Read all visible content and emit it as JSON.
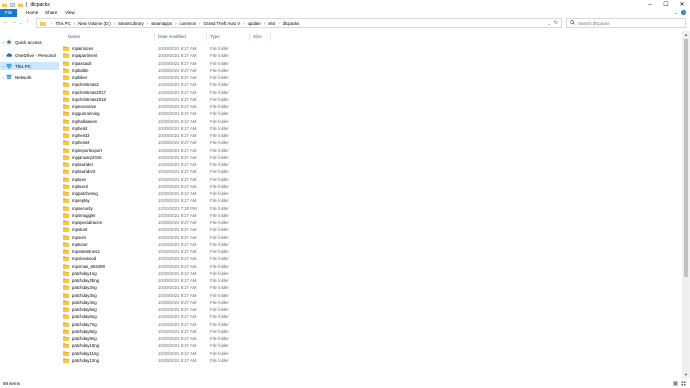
{
  "window": {
    "title": "dlcpacks",
    "qat_separator": "|",
    "controls": {
      "minimize": "–",
      "maximize": "☐",
      "close": "✕"
    }
  },
  "ribbon": {
    "tabs": [
      "File",
      "Home",
      "Share",
      "View"
    ],
    "help": "?"
  },
  "address_bar": {
    "crumbs": [
      "This PC",
      "New Volume (D:)",
      "SteamLibrary",
      "steamapps",
      "common",
      "Grand Theft Auto V",
      "update",
      "x64",
      "dlcpacks"
    ],
    "separator": "›"
  },
  "search": {
    "placeholder": "Search dlcpacks"
  },
  "nav": {
    "items": [
      {
        "label": "Quick access",
        "icon": "star-icon"
      },
      {
        "label": "OneDrive - Personal",
        "icon": "cloud-icon"
      },
      {
        "label": "This PC",
        "icon": "computer-icon"
      },
      {
        "label": "Network",
        "icon": "network-icon"
      }
    ]
  },
  "columns": {
    "name": "Name",
    "date": "Date modified",
    "type": "Type",
    "size": "Size"
  },
  "files": [
    {
      "name": "mpairraces",
      "date": "10/29/2021 9:27 AM",
      "type": "File folder"
    },
    {
      "name": "mpapartment",
      "date": "10/29/2021 9:27 AM",
      "type": "File folder"
    },
    {
      "name": "mpassault",
      "date": "10/29/2021 9:27 AM",
      "type": "File folder"
    },
    {
      "name": "mpbattle",
      "date": "10/29/2021 9:27 AM",
      "type": "File folder"
    },
    {
      "name": "mpbiker",
      "date": "10/29/2021 9:27 AM",
      "type": "File folder"
    },
    {
      "name": "mpchristmas2",
      "date": "10/29/2021 9:27 AM",
      "type": "File folder"
    },
    {
      "name": "mpchristmas2017",
      "date": "10/29/2021 9:27 AM",
      "type": "File folder"
    },
    {
      "name": "mpchristmas2018",
      "date": "10/29/2021 9:27 AM",
      "type": "File folder"
    },
    {
      "name": "mpexecutive",
      "date": "10/29/2021 9:27 AM",
      "type": "File folder"
    },
    {
      "name": "mpgunrunning",
      "date": "10/29/2021 9:27 AM",
      "type": "File folder"
    },
    {
      "name": "mphalloween",
      "date": "10/29/2021 9:27 AM",
      "type": "File folder"
    },
    {
      "name": "mpheist",
      "date": "10/29/2021 9:27 AM",
      "type": "File folder"
    },
    {
      "name": "mpheist3",
      "date": "10/29/2021 9:27 AM",
      "type": "File folder"
    },
    {
      "name": "mpheist4",
      "date": "10/29/2021 9:27 AM",
      "type": "File folder"
    },
    {
      "name": "mpimportexport",
      "date": "10/29/2021 9:27 AM",
      "type": "File folder"
    },
    {
      "name": "mpjanuary2016",
      "date": "10/29/2021 9:27 AM",
      "type": "File folder"
    },
    {
      "name": "mplowrider",
      "date": "10/29/2021 9:27 AM",
      "type": "File folder"
    },
    {
      "name": "mplowrider2",
      "date": "10/29/2021 9:27 AM",
      "type": "File folder"
    },
    {
      "name": "mpluxe",
      "date": "10/29/2021 9:27 AM",
      "type": "File folder"
    },
    {
      "name": "mpluxe2",
      "date": "10/29/2021 9:27 AM",
      "type": "File folder"
    },
    {
      "name": "mppatchesng",
      "date": "10/29/2021 9:27 AM",
      "type": "File folder"
    },
    {
      "name": "mpreplay",
      "date": "10/29/2021 9:27 AM",
      "type": "File folder"
    },
    {
      "name": "mpsecurity",
      "date": "12/24/2021 7:30 PM",
      "type": "File folder"
    },
    {
      "name": "mpsmuggler",
      "date": "10/29/2021 9:27 AM",
      "type": "File folder"
    },
    {
      "name": "mpspecialraces",
      "date": "10/29/2021 9:27 AM",
      "type": "File folder"
    },
    {
      "name": "mpstunt",
      "date": "10/29/2021 9:27 AM",
      "type": "File folder"
    },
    {
      "name": "mpsum",
      "date": "10/29/2021 9:27 AM",
      "type": "File folder"
    },
    {
      "name": "mptuner",
      "date": "10/29/2021 9:27 AM",
      "type": "File folder"
    },
    {
      "name": "mpvalentines2",
      "date": "10/29/2021 9:27 AM",
      "type": "File folder"
    },
    {
      "name": "mpvinewood",
      "date": "10/29/2021 9:27 AM",
      "type": "File folder"
    },
    {
      "name": "mpxmas_604490",
      "date": "10/29/2021 9:27 AM",
      "type": "File folder"
    },
    {
      "name": "patchday1ng",
      "date": "10/29/2021 9:27 AM",
      "type": "File folder"
    },
    {
      "name": "patchday2bng",
      "date": "10/29/2021 9:27 AM",
      "type": "File folder"
    },
    {
      "name": "patchday2ng",
      "date": "10/29/2021 9:27 AM",
      "type": "File folder"
    },
    {
      "name": "patchday3ng",
      "date": "10/29/2021 9:27 AM",
      "type": "File folder"
    },
    {
      "name": "patchday4ng",
      "date": "10/29/2021 9:27 AM",
      "type": "File folder"
    },
    {
      "name": "patchday5ng",
      "date": "10/29/2021 9:27 AM",
      "type": "File folder"
    },
    {
      "name": "patchday6ng",
      "date": "10/29/2021 9:27 AM",
      "type": "File folder"
    },
    {
      "name": "patchday7ng",
      "date": "10/29/2021 9:27 AM",
      "type": "File folder"
    },
    {
      "name": "patchday8ng",
      "date": "10/29/2021 9:27 AM",
      "type": "File folder"
    },
    {
      "name": "patchday9ng",
      "date": "10/29/2021 9:27 AM",
      "type": "File folder"
    },
    {
      "name": "patchday10ng",
      "date": "10/29/2021 9:27 AM",
      "type": "File folder"
    },
    {
      "name": "patchday11ng",
      "date": "10/29/2021 9:27 AM",
      "type": "File folder"
    },
    {
      "name": "patchday12ng",
      "date": "10/29/2021 9:27 AM",
      "type": "File folder"
    }
  ],
  "status": {
    "item_count": "58 items"
  },
  "colors": {
    "accent": "#1979ca",
    "folder": "#f8c848",
    "folder_dark": "#e0a828",
    "selection": "#cce8ff"
  }
}
